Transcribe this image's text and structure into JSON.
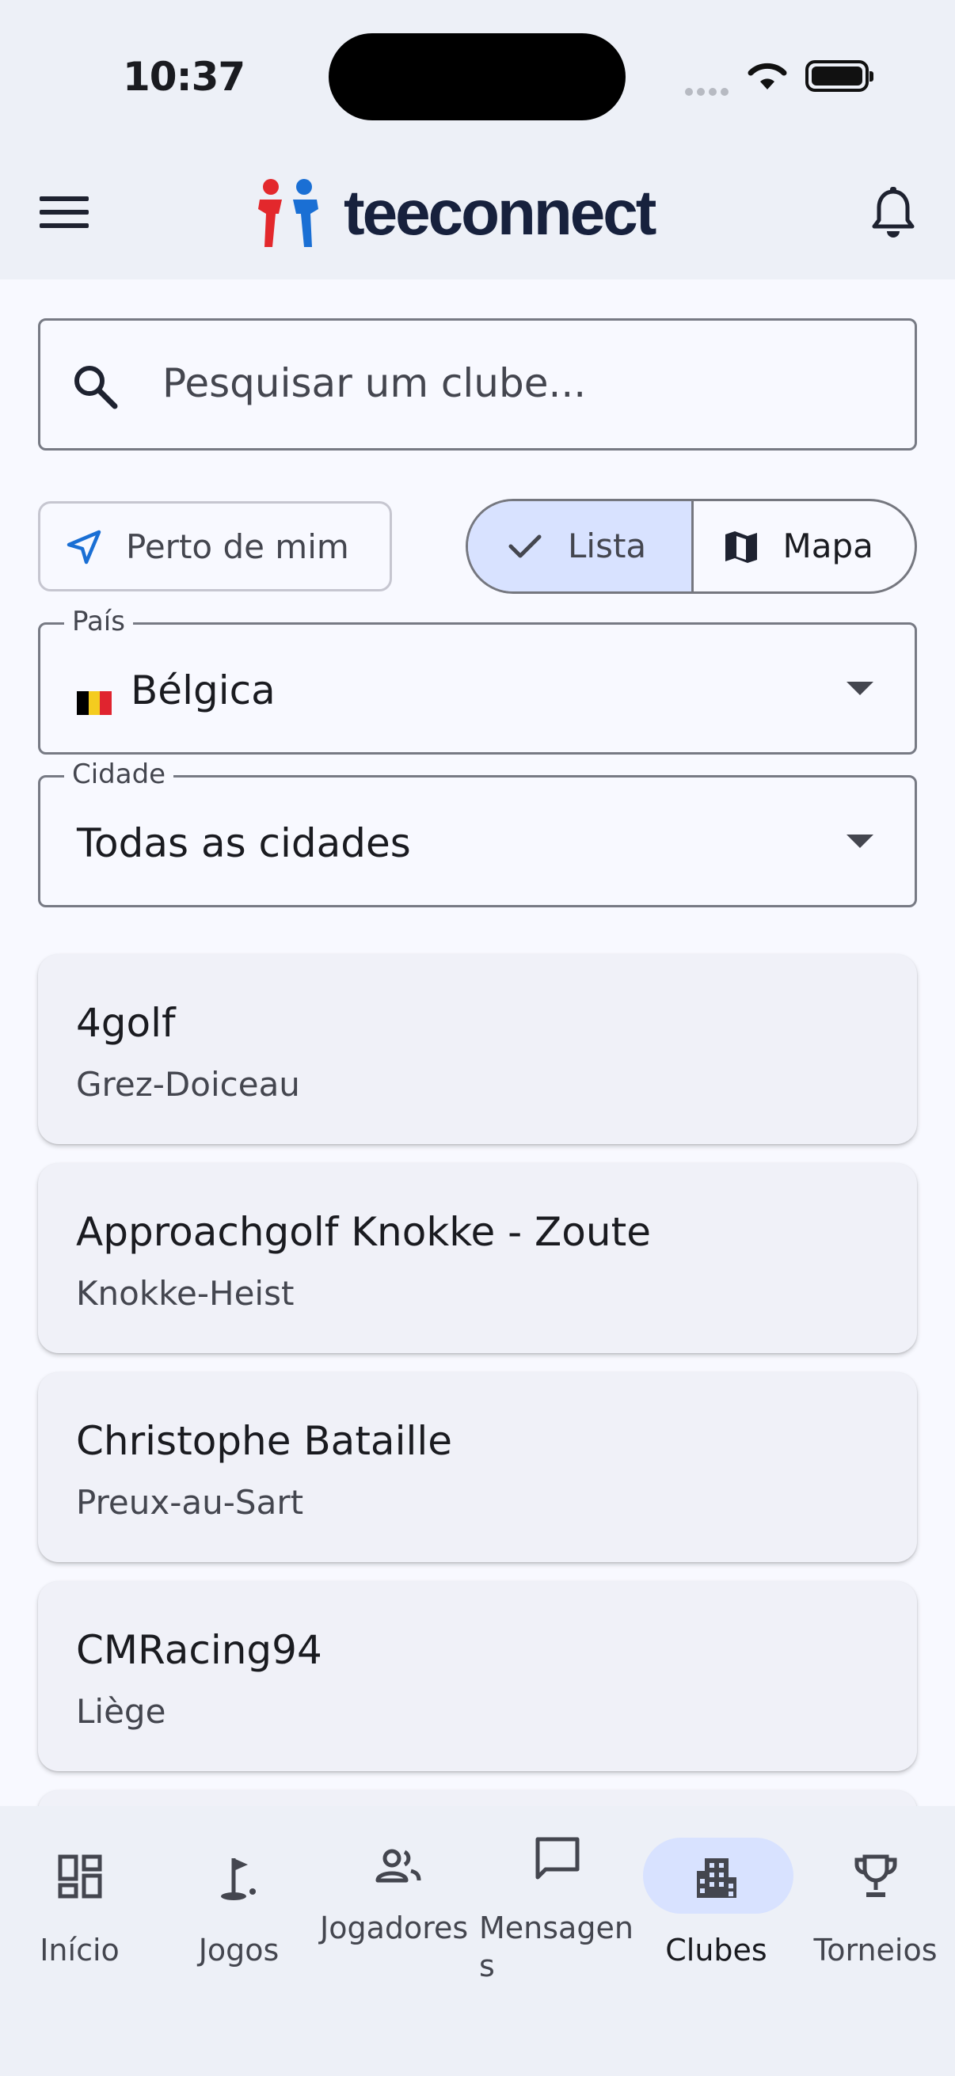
{
  "status_bar": {
    "time": "10:37"
  },
  "app_bar": {
    "logo_text": "teeconnect"
  },
  "search": {
    "placeholder": "Pesquisar um clube..."
  },
  "filters": {
    "near_me_label": "Perto de mim",
    "view_toggle": {
      "list_label": "Lista",
      "map_label": "Mapa",
      "selected": "Lista"
    },
    "country": {
      "label": "País",
      "value": "Bélgica",
      "flag": "belgium-flag"
    },
    "city": {
      "label": "Cidade",
      "value": "Todas as cidades"
    }
  },
  "clubs": [
    {
      "name": "4golf",
      "city": "Grez-Doiceau"
    },
    {
      "name": "Approachgolf Knokke - Zoute",
      "city": "Knokke-Heist"
    },
    {
      "name": "Christophe Bataille",
      "city": "Preux-au-Sart"
    },
    {
      "name": "CMRacing94",
      "city": "Liège"
    }
  ],
  "bottom_nav": [
    {
      "label": "Início",
      "icon": "dashboard-icon"
    },
    {
      "label": "Jogos",
      "icon": "golf-icon"
    },
    {
      "label": "Jogadores",
      "icon": "people-icon"
    },
    {
      "label": "Mensagens",
      "icon": "message-icon"
    },
    {
      "label": "Clubes",
      "icon": "building-icon",
      "active": true
    },
    {
      "label": "Torneios",
      "icon": "trophy-icon"
    }
  ],
  "colors": {
    "brand_red": "#e3282c",
    "brand_blue": "#1a6fd4",
    "logo_text": "#17213d",
    "selected_bg": "#d8e2ff"
  }
}
